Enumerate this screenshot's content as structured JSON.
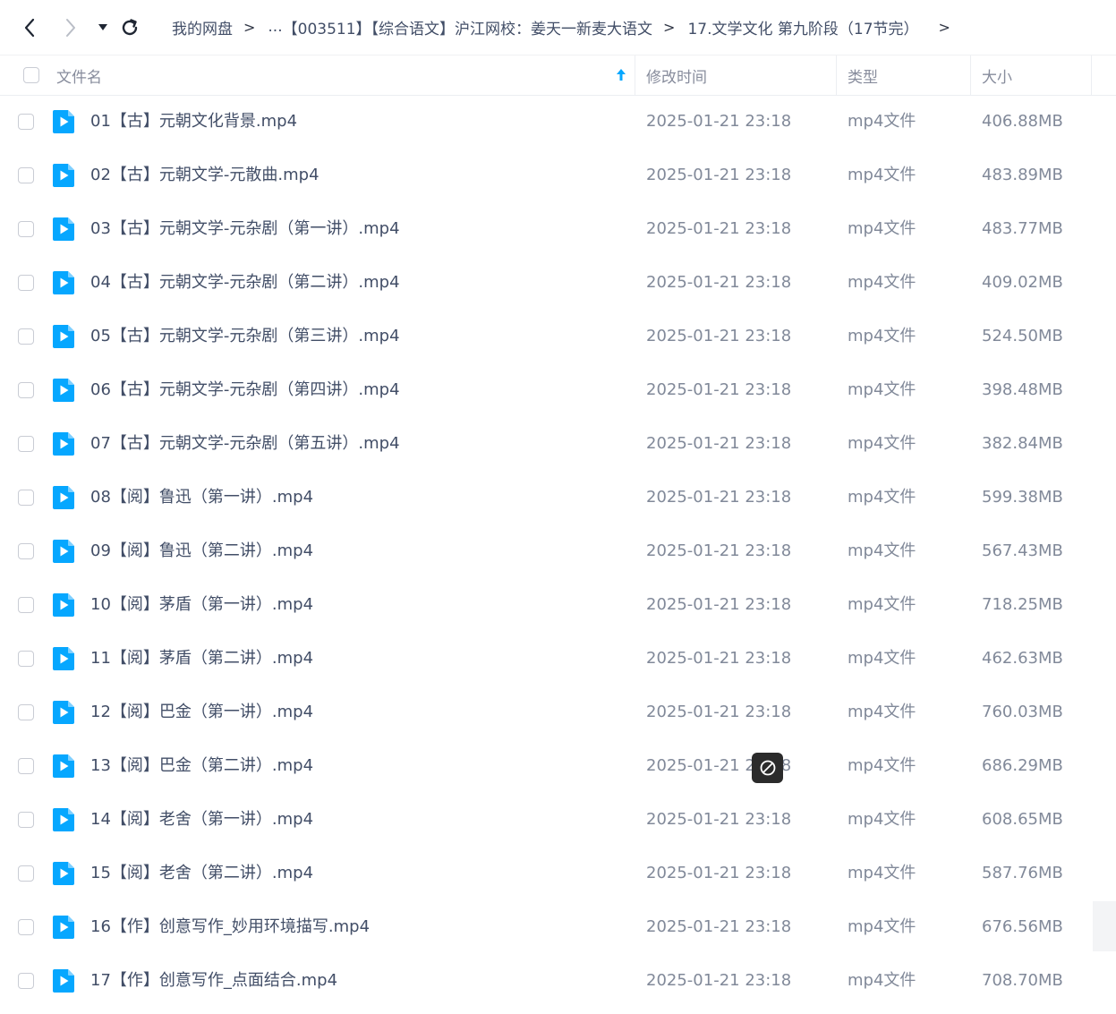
{
  "nav": {
    "back_icon": "chevron-left-icon",
    "forward_icon": "chevron-right-icon",
    "dropdown_icon": "caret-down-icon",
    "refresh_icon": "refresh-icon"
  },
  "breadcrumb": {
    "items": [
      "我的网盘",
      "...",
      "【003511】【综合语文】沪江网校：姜天一新麦大语文",
      "17.文学文化 第九阶段（17节完）"
    ],
    "separator": ">"
  },
  "table": {
    "headers": {
      "name": "文件名",
      "modified": "修改时间",
      "type": "类型",
      "size": "大小"
    },
    "sort_icon": "sort-up-arrow-icon",
    "rows": [
      {
        "name": "01【古】元朝文化背景.mp4",
        "modified": "2025-01-21 23:18",
        "type": "mp4文件",
        "size": "406.88MB"
      },
      {
        "name": "02【古】元朝文学-元散曲.mp4",
        "modified": "2025-01-21 23:18",
        "type": "mp4文件",
        "size": "483.89MB"
      },
      {
        "name": "03【古】元朝文学-元杂剧（第一讲）.mp4",
        "modified": "2025-01-21 23:18",
        "type": "mp4文件",
        "size": "483.77MB"
      },
      {
        "name": "04【古】元朝文学-元杂剧（第二讲）.mp4",
        "modified": "2025-01-21 23:18",
        "type": "mp4文件",
        "size": "409.02MB"
      },
      {
        "name": "05【古】元朝文学-元杂剧（第三讲）.mp4",
        "modified": "2025-01-21 23:18",
        "type": "mp4文件",
        "size": "524.50MB"
      },
      {
        "name": "06【古】元朝文学-元杂剧（第四讲）.mp4",
        "modified": "2025-01-21 23:18",
        "type": "mp4文件",
        "size": "398.48MB"
      },
      {
        "name": "07【古】元朝文学-元杂剧（第五讲）.mp4",
        "modified": "2025-01-21 23:18",
        "type": "mp4文件",
        "size": "382.84MB"
      },
      {
        "name": "08【阅】鲁迅（第一讲）.mp4",
        "modified": "2025-01-21 23:18",
        "type": "mp4文件",
        "size": "599.38MB"
      },
      {
        "name": "09【阅】鲁迅（第二讲）.mp4",
        "modified": "2025-01-21 23:18",
        "type": "mp4文件",
        "size": "567.43MB"
      },
      {
        "name": "10【阅】茅盾（第一讲）.mp4",
        "modified": "2025-01-21 23:18",
        "type": "mp4文件",
        "size": "718.25MB"
      },
      {
        "name": "11【阅】茅盾（第二讲）.mp4",
        "modified": "2025-01-21 23:18",
        "type": "mp4文件",
        "size": "462.63MB"
      },
      {
        "name": "12【阅】巴金（第一讲）.mp4",
        "modified": "2025-01-21 23:18",
        "type": "mp4文件",
        "size": "760.03MB"
      },
      {
        "name": "13【阅】巴金（第二讲）.mp4",
        "modified": "2025-01-21 23:18",
        "type": "mp4文件",
        "size": "686.29MB"
      },
      {
        "name": "14【阅】老舍（第一讲）.mp4",
        "modified": "2025-01-21 23:18",
        "type": "mp4文件",
        "size": "608.65MB"
      },
      {
        "name": "15【阅】老舍（第二讲）.mp4",
        "modified": "2025-01-21 23:18",
        "type": "mp4文件",
        "size": "587.76MB"
      },
      {
        "name": "16【作】创意写作_妙用环境描写.mp4",
        "modified": "2025-01-21 23:18",
        "type": "mp4文件",
        "size": "676.56MB"
      },
      {
        "name": "17【作】创意写作_点面结合.mp4",
        "modified": "2025-01-21 23:18",
        "type": "mp4文件",
        "size": "708.70MB"
      }
    ]
  },
  "file_icon": "video-file-icon",
  "overlay_icon": "prohibited-icon",
  "colors": {
    "accent": "#06a7ff",
    "text_primary": "#424e67",
    "text_secondary": "#818999"
  }
}
